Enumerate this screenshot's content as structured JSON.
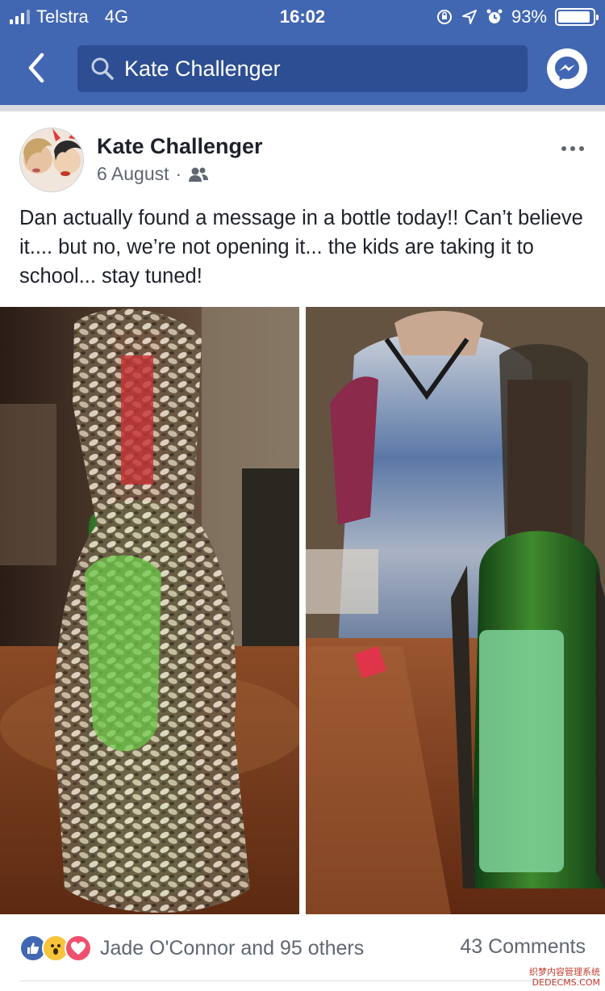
{
  "status_bar": {
    "carrier": "Telstra",
    "network": "4G",
    "time": "16:02",
    "battery": "93%",
    "battery_level": 0.93
  },
  "header": {
    "search_text": "Kate Challenger",
    "accent_color": "#4267b2"
  },
  "post": {
    "author": "Kate Challenger",
    "date": "6 August",
    "separator": "·",
    "audience_icon": "friends-icon",
    "text": "Dan actually found a message in a bottle today!! Can’t believe it.... but no, we’re not opening it... the kids are taking it to school... stay tuned!",
    "photos": [
      "barnacle-covered-bottle",
      "bottle-with-paper-message"
    ]
  },
  "footer": {
    "reactions": [
      "like",
      "wow",
      "love"
    ],
    "reactions_text": "Jade O'Connor and 95 others",
    "comments_text": "43 Comments"
  },
  "watermark": {
    "line1": "织梦内容管理系统",
    "line2": "DEDECMS.COM"
  }
}
